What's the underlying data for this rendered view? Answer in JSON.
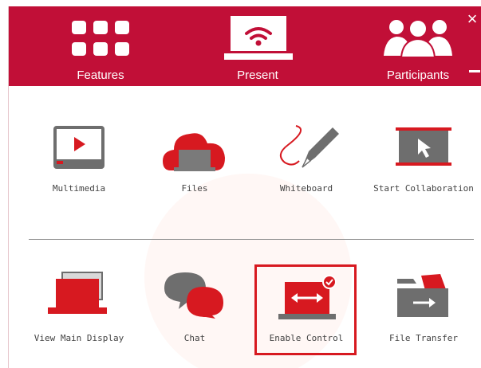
{
  "header": {
    "tabs": [
      {
        "id": "features",
        "label": "Features",
        "icon": "grid-icon"
      },
      {
        "id": "present",
        "label": "Present",
        "icon": "laptop-wifi-icon"
      },
      {
        "id": "participants",
        "label": "Participants",
        "icon": "people-icon"
      }
    ],
    "close_label": "×"
  },
  "tiles": [
    {
      "label": "Multimedia",
      "icon": "video-player-icon"
    },
    {
      "label": "Files",
      "icon": "cloud-laptop-icon"
    },
    {
      "label": "Whiteboard",
      "icon": "pen-icon"
    },
    {
      "label": "Start Collaboration",
      "icon": "pointer-board-icon"
    },
    {
      "label": "View Main Display",
      "icon": "laptop-display-icon"
    },
    {
      "label": "Chat",
      "icon": "chat-bubbles-icon"
    },
    {
      "label": "Enable Control",
      "icon": "remote-control-icon",
      "highlighted": true
    },
    {
      "label": "File Transfer",
      "icon": "folder-transfer-icon"
    }
  ],
  "colors": {
    "brand": "#c10f37",
    "accent": "#d71920",
    "icon_gray": "#6e6e6e",
    "highlight_border": "#d71920"
  }
}
